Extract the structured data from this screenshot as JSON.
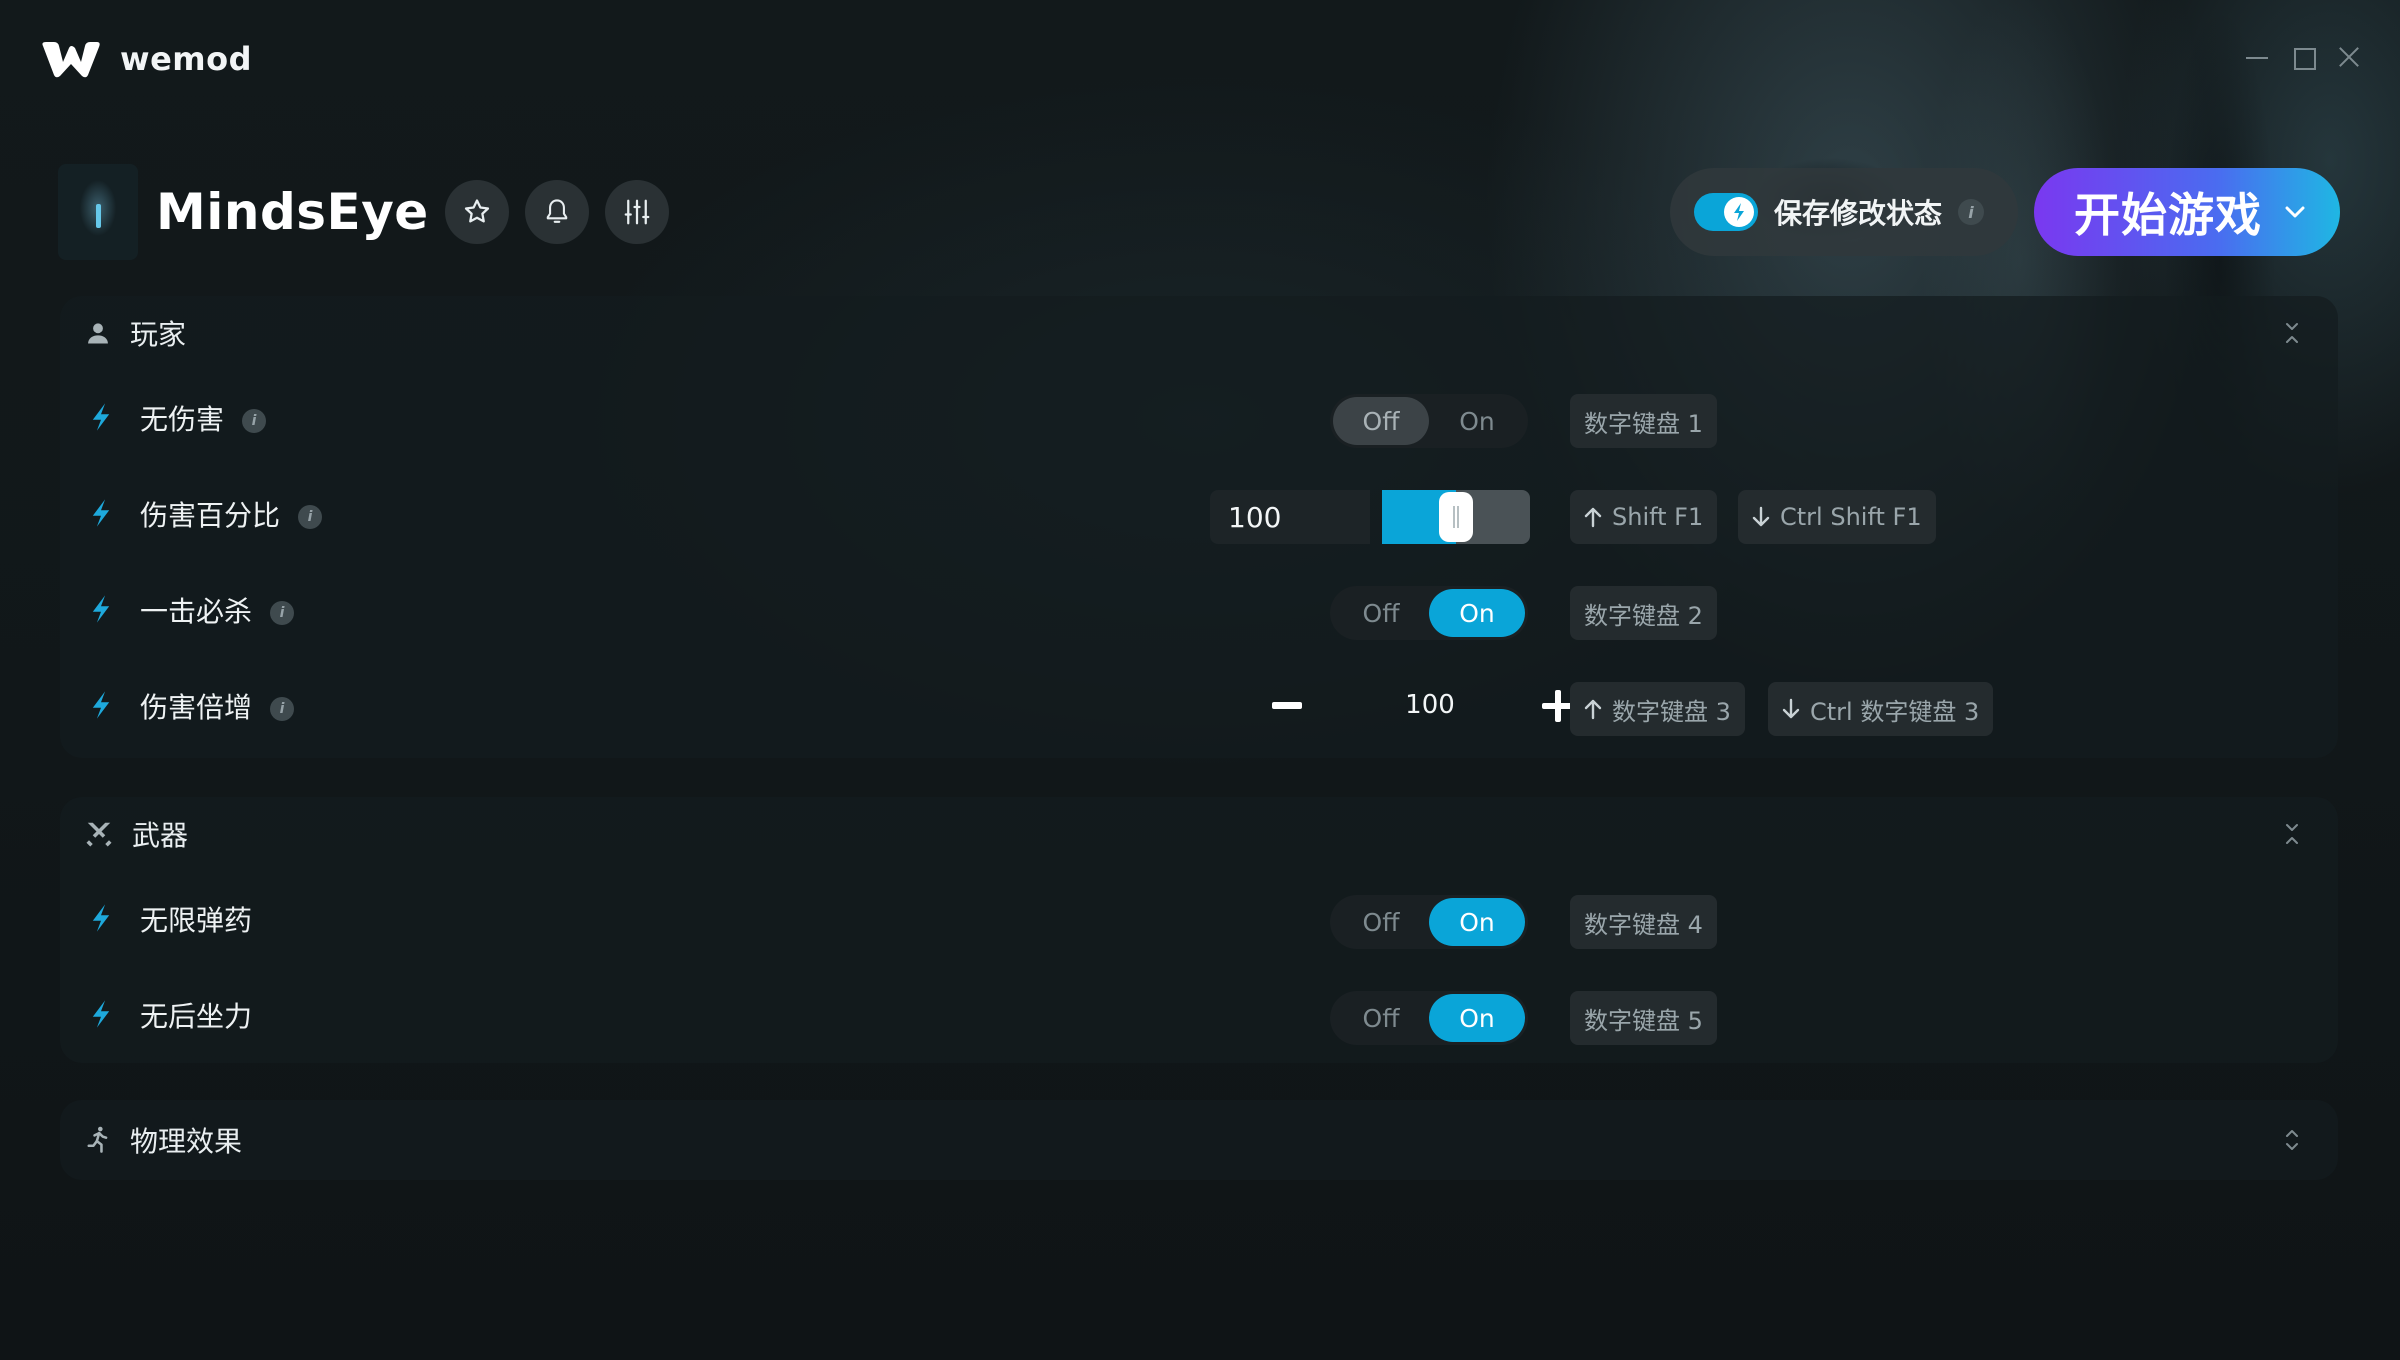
{
  "app": {
    "brand": "wemod"
  },
  "game": {
    "title": "MindsEye"
  },
  "header": {
    "save_mods_label": "保存修改状态",
    "save_mods_enabled": true,
    "info_glyph": "i",
    "play_label": "开始游戏"
  },
  "colors": {
    "accent": "#0aa5d8",
    "play_gradient": [
      "#7a38f0",
      "#1fb7e3"
    ]
  },
  "sections": [
    {
      "title": "玩家",
      "icon": "person-icon",
      "rows": [
        {
          "label": "无伤害",
          "type": "toggle",
          "off": "Off",
          "on": "On",
          "value": "Off",
          "hotkeys": [
            "数字键盘 1"
          ]
        },
        {
          "label": "伤害百分比",
          "type": "slider",
          "value": "100",
          "slider_fraction": 0.5,
          "hotkeys": [
            "Shift F1",
            "Ctrl Shift F1"
          ]
        },
        {
          "label": "一击必杀",
          "type": "toggle",
          "off": "Off",
          "on": "On",
          "value": "On",
          "hotkeys": [
            "数字键盘 2"
          ]
        },
        {
          "label": "伤害倍增",
          "type": "stepper",
          "value": "100",
          "hotkeys": [
            "数字键盘 3",
            "Ctrl 数字键盘 3"
          ]
        }
      ]
    },
    {
      "title": "武器",
      "icon": "crossed-swords-icon",
      "rows": [
        {
          "label": "无限弹药",
          "type": "toggle",
          "off": "Off",
          "on": "On",
          "value": "On",
          "hotkeys": [
            "数字键盘 4"
          ]
        },
        {
          "label": "无后坐力",
          "type": "toggle",
          "off": "Off",
          "on": "On",
          "value": "On",
          "hotkeys": [
            "数字键盘 5"
          ]
        }
      ]
    },
    {
      "title": "物理效果",
      "icon": "running-person-icon",
      "rows": []
    }
  ]
}
